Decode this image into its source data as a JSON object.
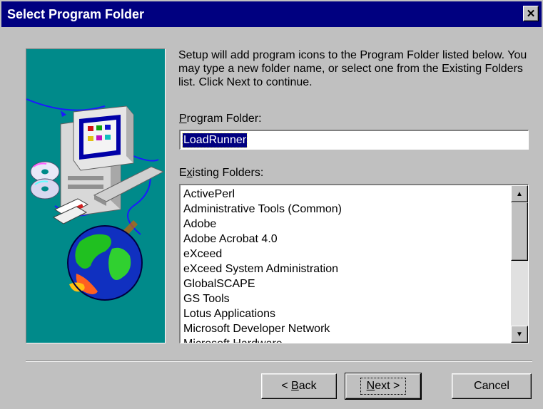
{
  "window": {
    "title": "Select Program Folder",
    "close_glyph": "✕"
  },
  "description": "Setup will add program icons to the Program Folder listed below. You may type a new folder name, or select one from the Existing Folders list.  Click Next to continue.",
  "program_folder": {
    "label_accel": "P",
    "label_rest": "rogram Folder:",
    "value": "LoadRunner"
  },
  "existing_folders": {
    "label_pre": "E",
    "label_accel": "x",
    "label_rest": "isting Folders:",
    "items": [
      "ActivePerl",
      "Administrative Tools (Common)",
      "Adobe",
      "Adobe Acrobat 4.0",
      "eXceed",
      "eXceed System Administration",
      "GlobalSCAPE",
      "GS Tools",
      "Lotus Applications",
      "Microsoft Developer Network",
      "Microsoft Hardware"
    ]
  },
  "buttons": {
    "back_prefix": "< ",
    "back_accel": "B",
    "back_rest": "ack",
    "next_accel": "N",
    "next_rest": "ext >",
    "cancel": "Cancel"
  },
  "colors": {
    "titlebar": "#000080",
    "face": "#c0c0c0",
    "art_bg": "#008a8a",
    "selection": "#000080"
  },
  "icons": {
    "close": "close-icon",
    "scroll_up": "scroll-up-arrow-icon",
    "scroll_down": "scroll-down-arrow-icon",
    "art": "computer-cd-globe-illustration"
  }
}
